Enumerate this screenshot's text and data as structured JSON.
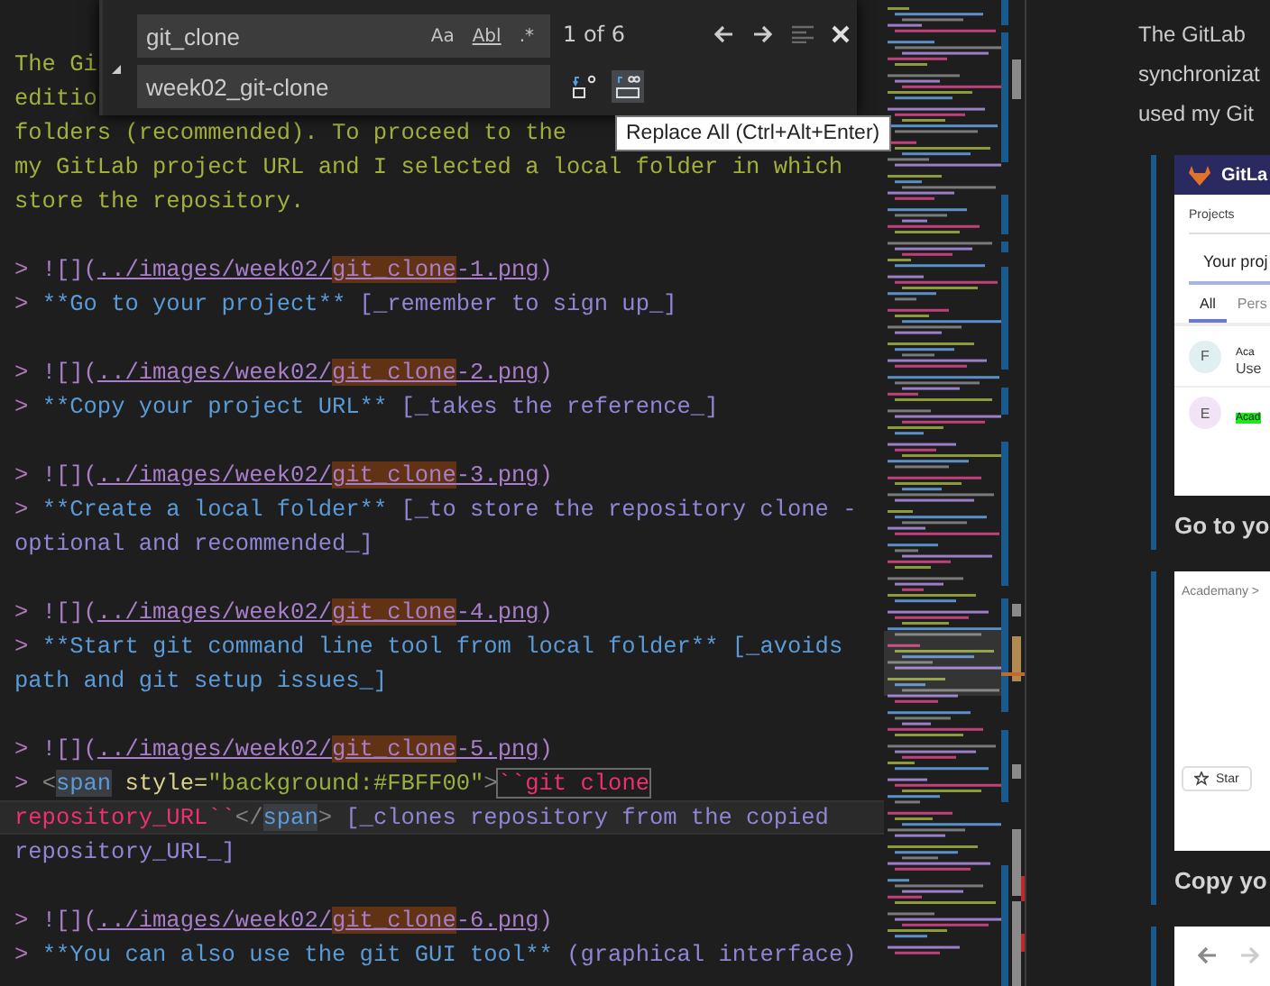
{
  "find_widget": {
    "expanded": true,
    "find_value": "git_clone",
    "toggles": [
      {
        "label": "Aa",
        "on": false
      },
      {
        "label": "Abl",
        "on": false
      },
      {
        "label": ".*",
        "on": false
      }
    ],
    "match_count": "1 of 6",
    "replace_value": "week02_git-clone"
  },
  "tooltip": "Replace All (Ctrl+Alt+Enter)",
  "editor_lines": [
    {
      "kind": "code",
      "current": false,
      "segments": [
        {
          "text": "The Gi",
          "kind": "plain"
        }
      ]
    },
    {
      "kind": "code",
      "current": false,
      "segments": [
        {
          "text": "editio",
          "kind": "plain"
        }
      ]
    },
    {
      "kind": "code",
      "current": false,
      "segments": [
        {
          "text": "folders (recommended). To proceed to the",
          "kind": "plain"
        }
      ]
    },
    {
      "kind": "code",
      "current": false,
      "segments": [
        {
          "text": "my GitLab project URL and I selected a local folder in which",
          "kind": "plain"
        }
      ]
    },
    {
      "kind": "code",
      "current": false,
      "segments": [
        {
          "text": "store the repository.",
          "kind": "plain"
        }
      ]
    },
    {
      "kind": "blank",
      "current": false
    },
    {
      "kind": "code",
      "current": false,
      "segments": [
        {
          "text": "> ",
          "kind": "marker"
        },
        {
          "text": "![](",
          "kind": "link"
        },
        {
          "text": "../images/week02/",
          "kind": "url"
        },
        {
          "text": "git_clone",
          "kind": "match"
        },
        {
          "text": "-1.png",
          "kind": "url"
        },
        {
          "text": ")",
          "kind": "link"
        }
      ]
    },
    {
      "kind": "code",
      "current": false,
      "segments": [
        {
          "text": "> ",
          "kind": "marker"
        },
        {
          "text": "**Go to your project**",
          "kind": "bold"
        },
        {
          "text": " [_remember to sign up_]",
          "kind": "emphasis"
        }
      ]
    },
    {
      "kind": "blank",
      "current": false
    },
    {
      "kind": "code",
      "current": false,
      "segments": [
        {
          "text": "> ",
          "kind": "marker"
        },
        {
          "text": "![](",
          "kind": "link"
        },
        {
          "text": "../images/week02/",
          "kind": "url"
        },
        {
          "text": "git_clone",
          "kind": "match"
        },
        {
          "text": "-2.png",
          "kind": "url"
        },
        {
          "text": ")",
          "kind": "link"
        }
      ]
    },
    {
      "kind": "code",
      "current": false,
      "segments": [
        {
          "text": "> ",
          "kind": "marker"
        },
        {
          "text": "**Copy your project URL**",
          "kind": "bold"
        },
        {
          "text": " [_takes the reference_]",
          "kind": "emphasis"
        }
      ]
    },
    {
      "kind": "blank",
      "current": false
    },
    {
      "kind": "code",
      "current": false,
      "segments": [
        {
          "text": "> ",
          "kind": "marker"
        },
        {
          "text": "![](",
          "kind": "link"
        },
        {
          "text": "../images/week02/",
          "kind": "url"
        },
        {
          "text": "git_clone",
          "kind": "match"
        },
        {
          "text": "-3.png",
          "kind": "url"
        },
        {
          "text": ")",
          "kind": "link"
        }
      ]
    },
    {
      "kind": "code",
      "current": false,
      "segments": [
        {
          "text": "> ",
          "kind": "marker"
        },
        {
          "text": "**Create a local folder**",
          "kind": "bold"
        },
        {
          "text": " [_to store the repository clone -",
          "kind": "emphasis"
        }
      ]
    },
    {
      "kind": "code",
      "current": false,
      "segments": [
        {
          "text": "optional and recommended_]",
          "kind": "emphasis"
        }
      ]
    },
    {
      "kind": "blank",
      "current": false
    },
    {
      "kind": "code",
      "current": false,
      "segments": [
        {
          "text": "> ",
          "kind": "marker"
        },
        {
          "text": "![](",
          "kind": "link"
        },
        {
          "text": "../images/week02/",
          "kind": "url"
        },
        {
          "text": "git_clone",
          "kind": "match"
        },
        {
          "text": "-4.png",
          "kind": "url"
        },
        {
          "text": ")",
          "kind": "link"
        }
      ]
    },
    {
      "kind": "code",
      "current": false,
      "segments": [
        {
          "text": "> ",
          "kind": "marker"
        },
        {
          "text": "**Start git command line tool from local folder**",
          "kind": "bold"
        },
        {
          "text": " [_avoids",
          "kind": "bold"
        }
      ]
    },
    {
      "kind": "code",
      "current": false,
      "segments": [
        {
          "text": "path and git setup issues_]",
          "kind": "bold"
        }
      ]
    },
    {
      "kind": "blank",
      "current": false
    },
    {
      "kind": "code",
      "current": false,
      "segments": [
        {
          "text": "> ",
          "kind": "marker"
        },
        {
          "text": "![](",
          "kind": "link"
        },
        {
          "text": "../images/week02/",
          "kind": "url"
        },
        {
          "text": "git_clone",
          "kind": "match"
        },
        {
          "text": "-5.png",
          "kind": "url"
        },
        {
          "text": ")",
          "kind": "link"
        }
      ]
    },
    {
      "kind": "code",
      "current": false,
      "segments": [
        {
          "text": "> ",
          "kind": "marker"
        },
        {
          "text": "<",
          "kind": "tag"
        },
        {
          "text": "span",
          "kind": "tag_name"
        },
        {
          "text": " style=",
          "kind": "attr"
        },
        {
          "text": "\"background:#FBFF00\"",
          "kind": "string"
        },
        {
          "text": ">",
          "kind": "tag"
        },
        {
          "text": "``git clone",
          "kind": "code_boxed"
        }
      ]
    },
    {
      "kind": "code",
      "current": true,
      "segments": [
        {
          "text": "repository_URL``",
          "kind": "code"
        },
        {
          "text": "</",
          "kind": "tag"
        },
        {
          "text": "span",
          "kind": "tag_name"
        },
        {
          "text": ">",
          "kind": "tag"
        },
        {
          "text": " [_clones repository from the copied",
          "kind": "emphasis"
        }
      ]
    },
    {
      "kind": "code",
      "current": false,
      "segments": [
        {
          "text": "repository_URL_]",
          "kind": "emphasis"
        }
      ]
    },
    {
      "kind": "blank",
      "current": false
    },
    {
      "kind": "code",
      "current": false,
      "segments": [
        {
          "text": "> ",
          "kind": "marker"
        },
        {
          "text": "![](",
          "kind": "link"
        },
        {
          "text": "../images/week02/",
          "kind": "url"
        },
        {
          "text": "git_clone",
          "kind": "match"
        },
        {
          "text": "-6.png",
          "kind": "url"
        },
        {
          "text": ")",
          "kind": "link"
        }
      ]
    },
    {
      "kind": "code",
      "current": false,
      "segments": [
        {
          "text": "> ",
          "kind": "marker"
        },
        {
          "text": "**You can also use the git GUI tool**",
          "kind": "bold"
        },
        {
          "text": " (graphical interface)",
          "kind": "emphasis"
        }
      ]
    }
  ],
  "preview": {
    "paragraph_lines": [
      "The GitLab",
      "synchronizat",
      "used my Git"
    ],
    "blocks": [
      {
        "kind": "projects",
        "brand": "GitLa",
        "heading": "Projects",
        "tab_title": "Your proj",
        "filters": [
          {
            "label": "All",
            "selected": true
          },
          {
            "label": "Pers",
            "selected": false
          }
        ],
        "rows": [
          {
            "avatar": "F",
            "title": "Aca",
            "subtitle": "Use",
            "highlighted": false
          },
          {
            "avatar": "E",
            "title": "Acad",
            "highlighted": true
          }
        ],
        "caption": "Go to yo"
      },
      {
        "kind": "repo",
        "breadcrumb": "Academany >",
        "button": "Star",
        "caption": "Copy yo"
      },
      {
        "kind": "browser"
      }
    ]
  }
}
